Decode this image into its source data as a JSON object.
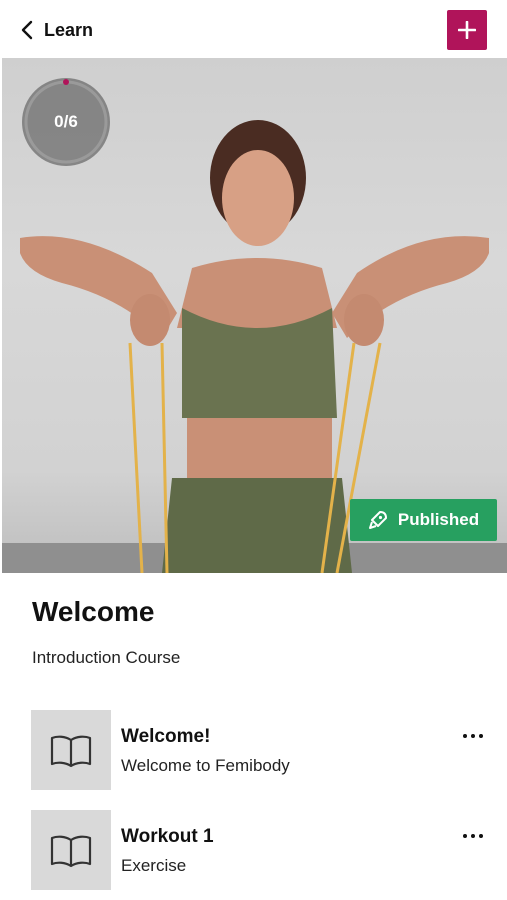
{
  "header": {
    "back_label": "Learn",
    "add_icon": "plus-icon",
    "add_color": "#b0145a"
  },
  "hero": {
    "progress_text": "0/6",
    "status_label": "Published",
    "status_color": "#27a060"
  },
  "course": {
    "title": "Welcome",
    "subtitle": "Introduction Course"
  },
  "lessons": [
    {
      "title": "Welcome!",
      "subtitle": "Welcome to Femibody",
      "icon": "book-icon"
    },
    {
      "title": "Workout 1",
      "subtitle": "Exercise",
      "icon": "book-icon"
    }
  ]
}
